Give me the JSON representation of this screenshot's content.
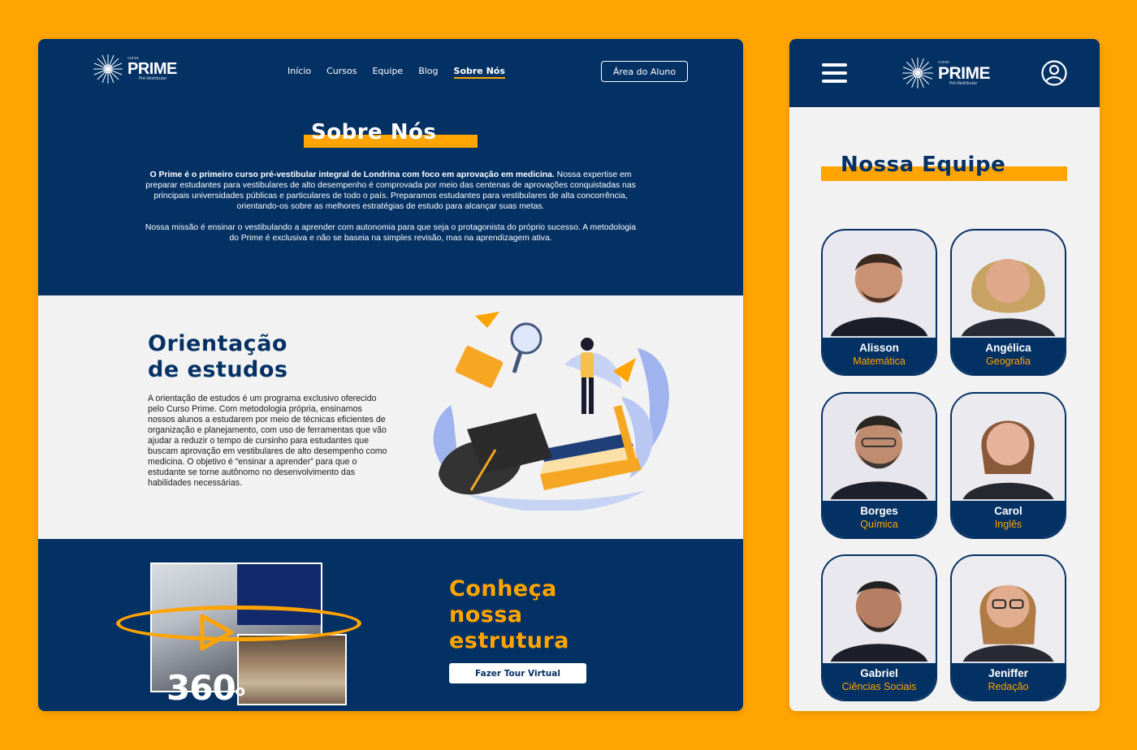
{
  "colors": {
    "navy": "#043164",
    "orange": "#FFA400",
    "light": "#F2F2F2",
    "white": "#FFFFFF"
  },
  "brand": {
    "small": "curso",
    "name": "PRIME",
    "tagline": "Pré-Vestibular",
    "logo_icon": "starburst-icon"
  },
  "desktop": {
    "nav": [
      "Início",
      "Cursos",
      "Equipe",
      "Blog",
      "Sobre Nós"
    ],
    "nav_active": "Sobre Nós",
    "student_area_button": "Área do Aluno",
    "about": {
      "title": "Sobre Nós",
      "lead_bold": "O Prime é o primeiro curso pré-vestibular integral de Londrina com foco em aprovação em medicina.",
      "lead_rest": " Nossa expertise em preparar estudantes para vestibulares de alto desempenho é comprovada por meio das centenas de aprovações conquistadas nas principais universidades públicas e particulares de todo o país.  Preparamos estudantes para vestibulares de alta concorrência, orientando-os sobre as melhores estratégias de estudo para alcançar suas metas.",
      "mission": "Nossa missão é ensinar o vestibulando a aprender com autonomia para que seja o protagonista do próprio sucesso. A metodologia do Prime é exclusiva e não se baseia na simples revisão, mas na aprendizagem ativa."
    },
    "orientation": {
      "title_line1": "Orientação",
      "title_line2": "de estudos",
      "text": "A orientação de estudos é um programa exclusivo oferecido pelo Curso Prime. Com metodologia própria, ensinamos nossos alunos a estudarem por meio de técnicas eficientes de organização e planejamento, com uso de ferramentas que vão ajudar a reduzir o tempo de cursinho para estudantes que buscam aprovação em vestibulares de alto desempenho como medicina. O objetivo é “ensinar a aprender” para que o estudante se torne autônomo no desenvolvimento das habilidades necessárias."
    },
    "structure": {
      "title_line1": "Conheça",
      "title_line2": "nossa",
      "title_line3": "estrutura",
      "tour_button": "Fazer Tour Virtual",
      "badge_number": "360",
      "badge_degree": "o"
    }
  },
  "mobile": {
    "team_title": "Nossa Equipe",
    "members": [
      {
        "name": "Alisson",
        "subject": "Matemática"
      },
      {
        "name": "Angélica",
        "subject": "Geografia"
      },
      {
        "name": "Borges",
        "subject": "Química"
      },
      {
        "name": "Carol",
        "subject": "Inglês"
      },
      {
        "name": "Gabriel",
        "subject": "Ciências Sociais"
      },
      {
        "name": "Jeniffer",
        "subject": "Redação"
      }
    ]
  }
}
